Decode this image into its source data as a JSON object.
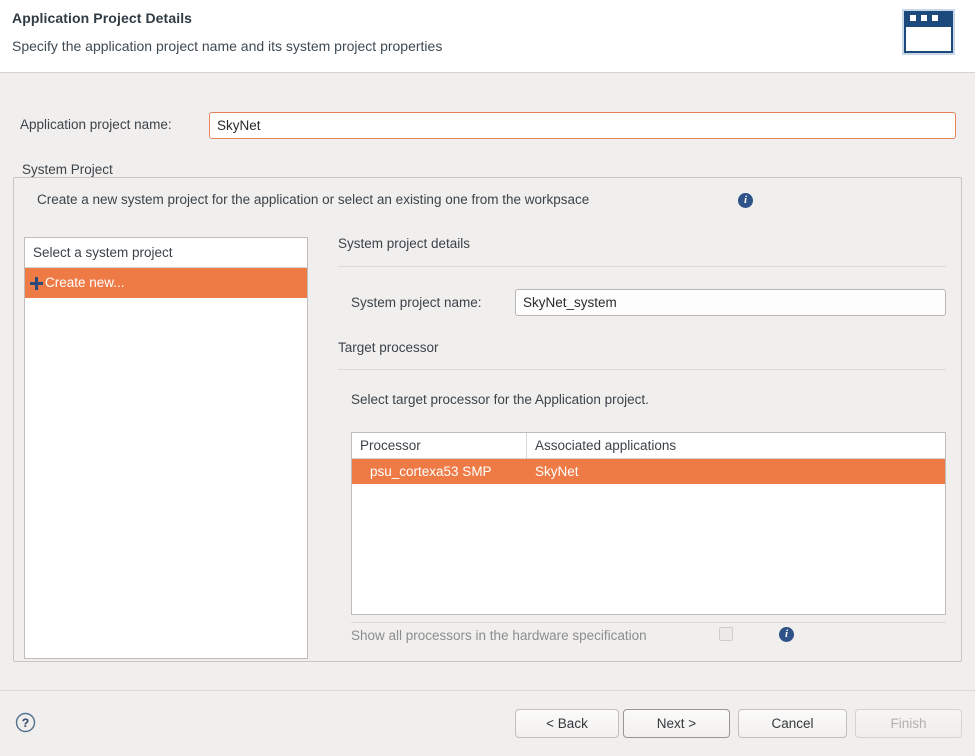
{
  "header": {
    "title": "Application Project Details",
    "subtitle": "Specify the application project name and its system project properties",
    "icon": "window-dialog-icon"
  },
  "app_project": {
    "label": "Application project name:",
    "value": "SkyNet",
    "placeholder": ""
  },
  "system_project_group": {
    "legend": "System Project",
    "description": "Create a new system project for the application or select an existing one from the workpsace",
    "info_icon": "info-icon"
  },
  "system_list": {
    "header": "Select a system project",
    "items": [
      {
        "label": "Create new...",
        "icon": "plus-icon",
        "selected": true
      }
    ]
  },
  "details": {
    "section_title": "System project details",
    "system_name_label": "System project name:",
    "system_name_value": "SkyNet_system",
    "system_name_placeholder": ""
  },
  "target_processor": {
    "section_title": "Target processor",
    "description": "Select target processor for the Application project.",
    "columns": [
      "Processor",
      "Associated applications"
    ],
    "rows": [
      {
        "processor": "psu_cortexa53 SMP",
        "applications": "SkyNet",
        "selected": true
      }
    ],
    "show_all_label": "Show all processors in the hardware specification",
    "show_all_checked": false,
    "info_icon": "info-icon"
  },
  "footer": {
    "help_icon": "help-icon",
    "buttons": {
      "back": "< Back",
      "next": "Next >",
      "cancel": "Cancel",
      "finish": "Finish"
    }
  },
  "colors": {
    "selection_orange": "#ee7b46",
    "focus_border": "#e8825a",
    "info_blue": "#2f5288",
    "icon_navy": "#1d4a7c",
    "body_background": "#f0efee"
  }
}
